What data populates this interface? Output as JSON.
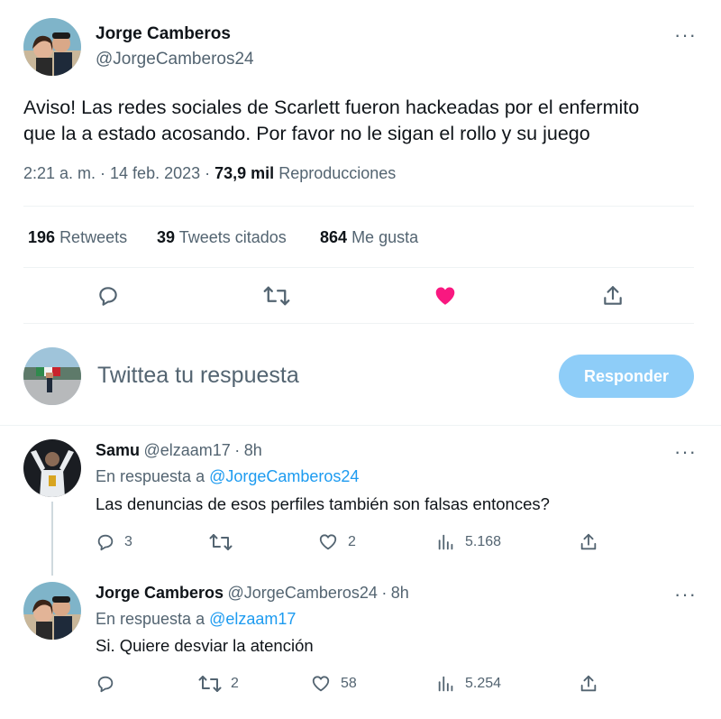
{
  "tweet": {
    "author_name": "Jorge Camberos",
    "author_handle": "@JorgeCamberos24",
    "more_label": "···",
    "text_line1": "Aviso! Las redes sociales de Scarlett fueron hackeadas por el enfermito",
    "text_line2": "que la a estado acosando. Por favor no le sigan el rollo y su juego",
    "time": "2:21 a. m. · 14 feb. 2023 ·",
    "views_count": "73,9 mil",
    "views_label": "Reproducciones",
    "retweets_count": "196",
    "retweets_label": "Retweets",
    "quotes_count": "39",
    "quotes_label": "Tweets citados",
    "likes_count": "864",
    "likes_label": "Me gusta",
    "liked": true,
    "like_color": "#f91880"
  },
  "composer": {
    "placeholder": "Twittea tu respuesta",
    "button_label": "Responder"
  },
  "replies": [
    {
      "name": "Samu",
      "handle": "@elzaam17",
      "sep": "·",
      "age": "8h",
      "in_reply_prefix": "En respuesta a",
      "in_reply_to": "@JorgeCamberos24",
      "text": "Las denuncias de esos perfiles también son falsas entonces?",
      "reply_count": "3",
      "retweet_count": "",
      "like_count": "2",
      "view_count": "5.168"
    },
    {
      "name": "Jorge Camberos",
      "handle": "@JorgeCamberos24",
      "sep": "·",
      "age": "8h",
      "in_reply_prefix": "En respuesta a",
      "in_reply_to": "@elzaam17",
      "text": "Si. Quiere desviar la atención",
      "reply_count": "",
      "retweet_count": "2",
      "like_count": "58",
      "view_count": "5.254"
    }
  ],
  "colors": {
    "accent": "#1d9bf0",
    "button_disabled": "#8ecdf8",
    "text_secondary": "#536471"
  }
}
